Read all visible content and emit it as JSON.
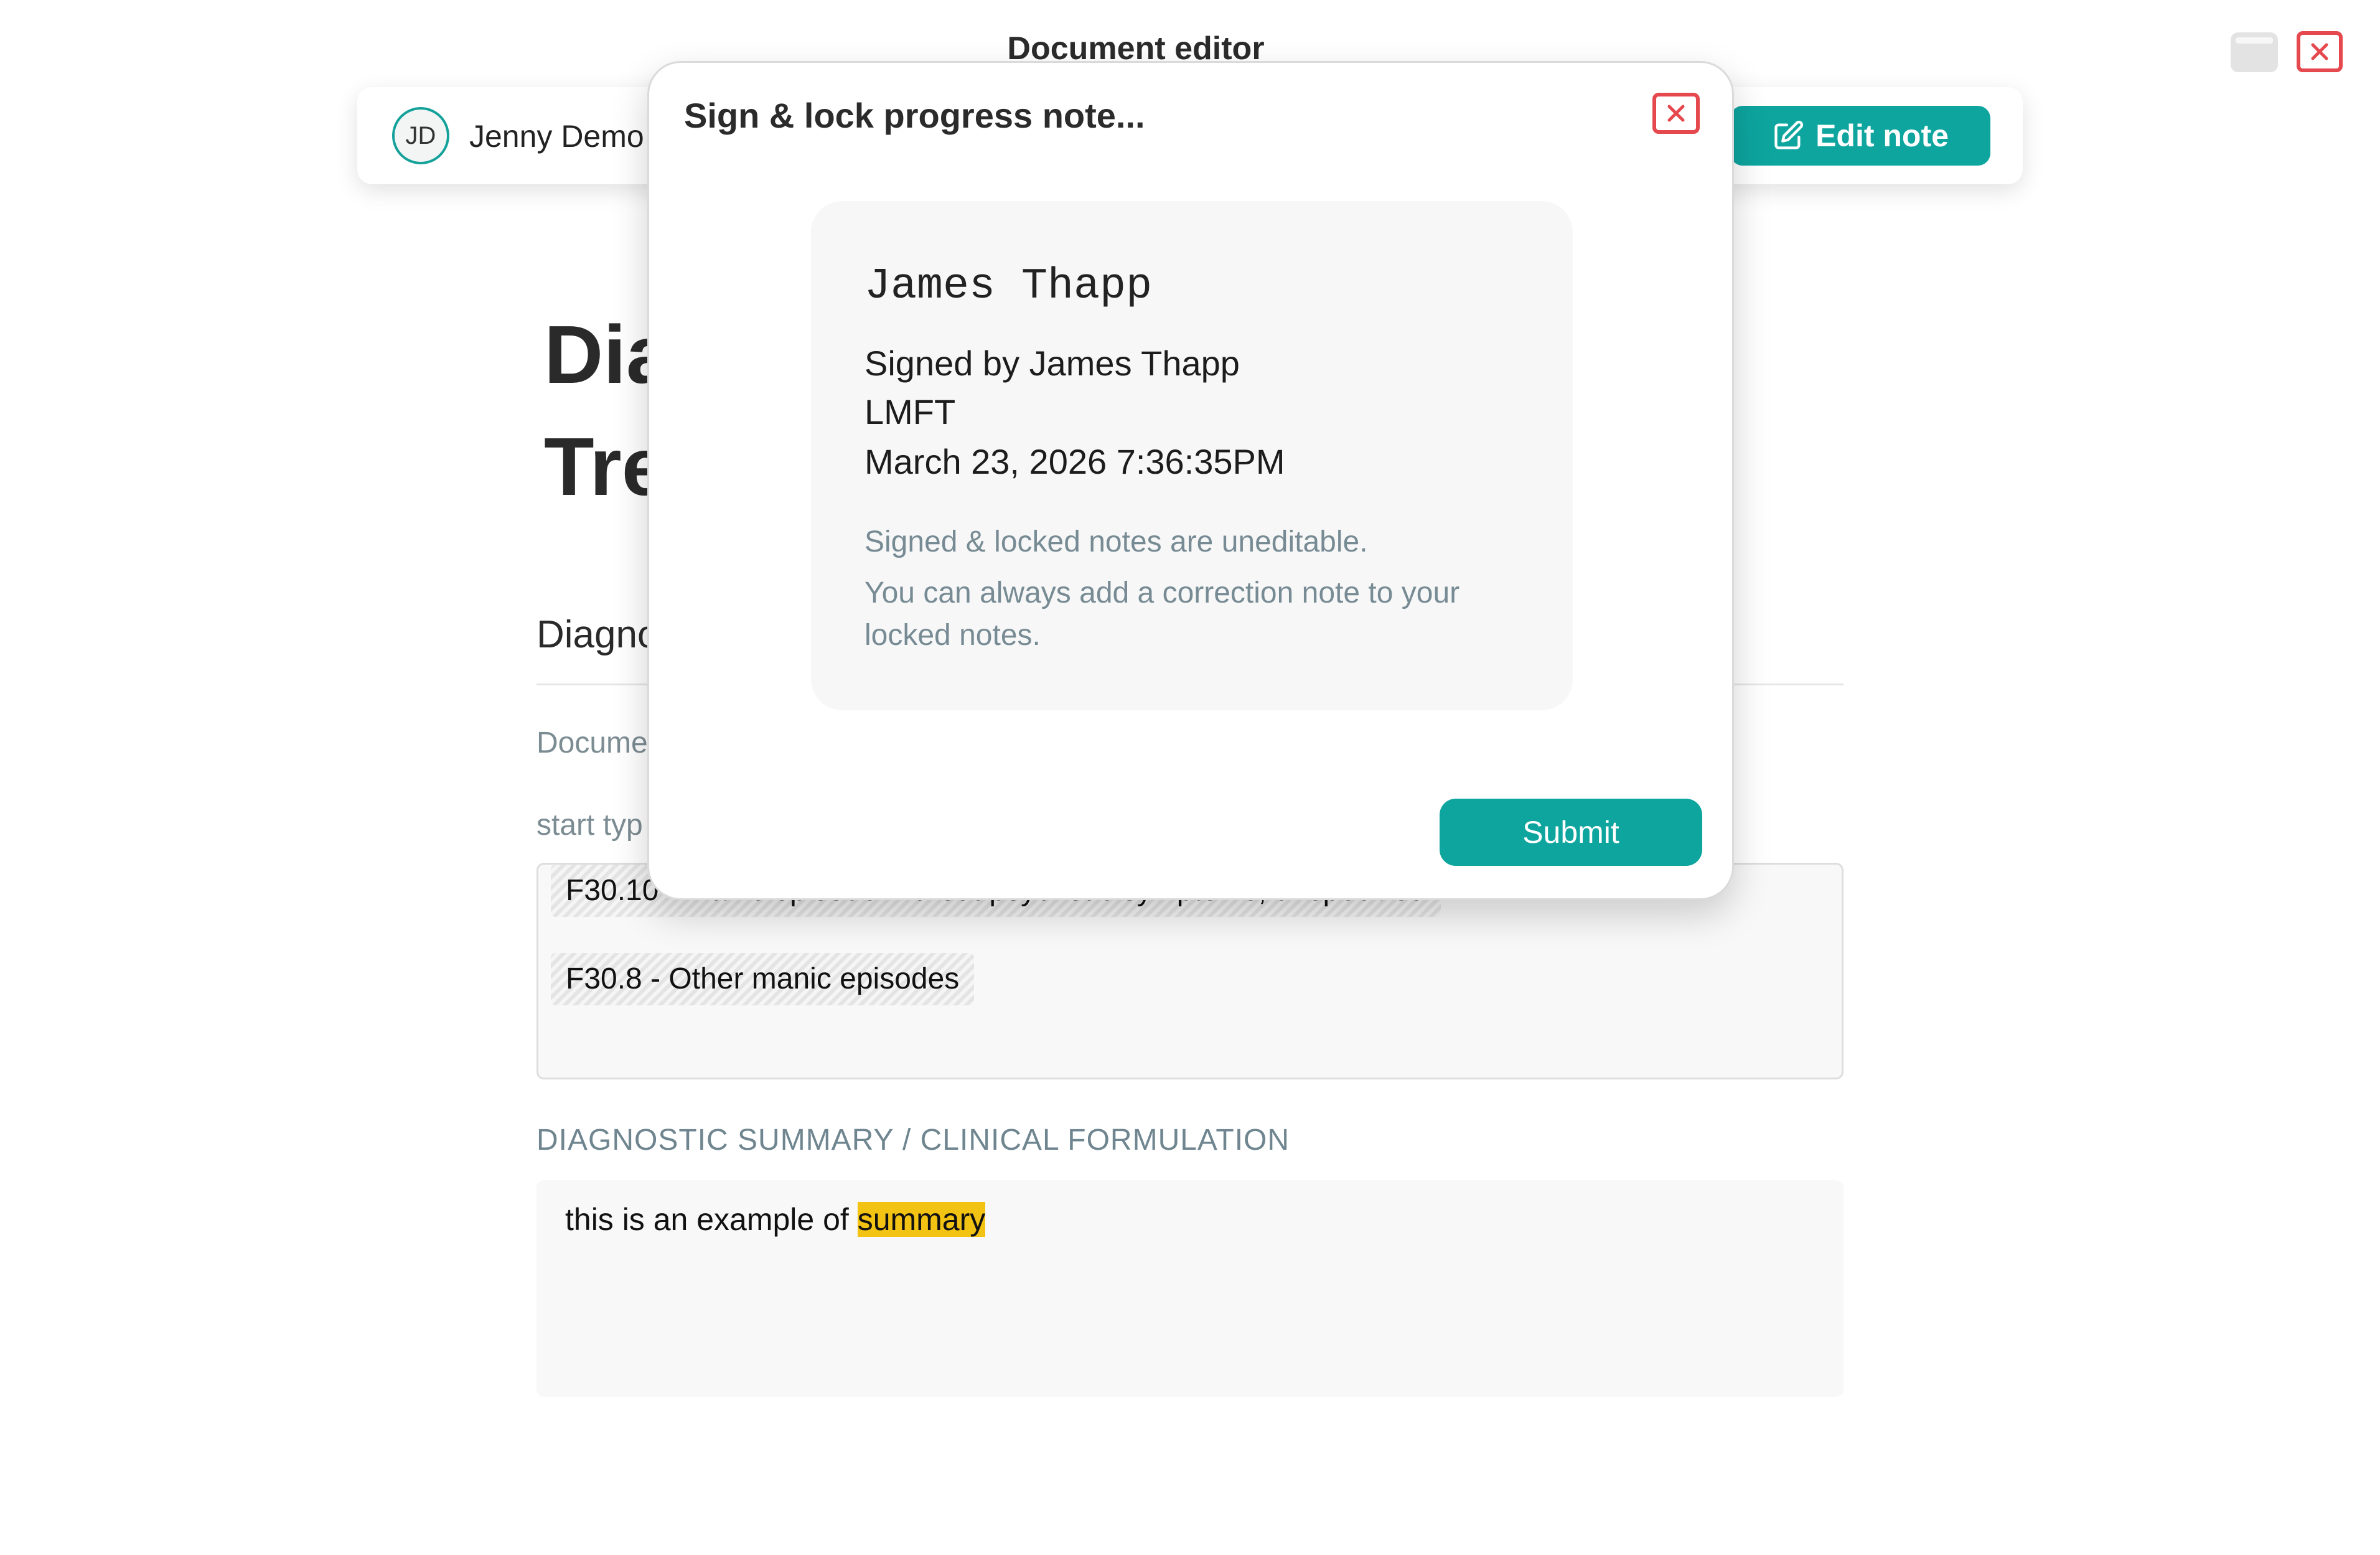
{
  "window": {
    "title": "Document editor",
    "controls": {
      "minimize_icon": "window-minimize-icon",
      "close_icon": "close-icon"
    }
  },
  "toolbar": {
    "avatar_initials": "JD",
    "user_name": "Jenny Demo",
    "edit_label": "Edit note",
    "edit_icon": "edit-icon"
  },
  "document": {
    "title_line1": "Dia",
    "title_line2": "Tre",
    "section_heading": "Diagno",
    "subtext": "Docume",
    "hint": "start typ",
    "diagnoses": [
      "F30.10 - Manic episode without psychotic symptoms, unspecified",
      "F30.8 - Other manic episodes"
    ],
    "summary_label": "DIAGNOSTIC SUMMARY / CLINICAL FORMULATION",
    "summary_text_prefix": "this is an example of ",
    "summary_text_highlight": "summary"
  },
  "modal": {
    "title": "Sign & lock progress note...",
    "signature_script": "James Thapp",
    "signed_by": "Signed by James Thapp",
    "credential": "LMFT",
    "timestamp": "March 23, 2026 7:36:35PM",
    "note_line1": "Signed & locked notes are uneditable.",
    "note_line2": "You can always add a correction note to your locked notes.",
    "submit_label": "Submit"
  },
  "colors": {
    "accent": "#0ea59f",
    "close_red": "#e5484d",
    "highlight": "#f2c313",
    "muted_text": "#778b94"
  }
}
